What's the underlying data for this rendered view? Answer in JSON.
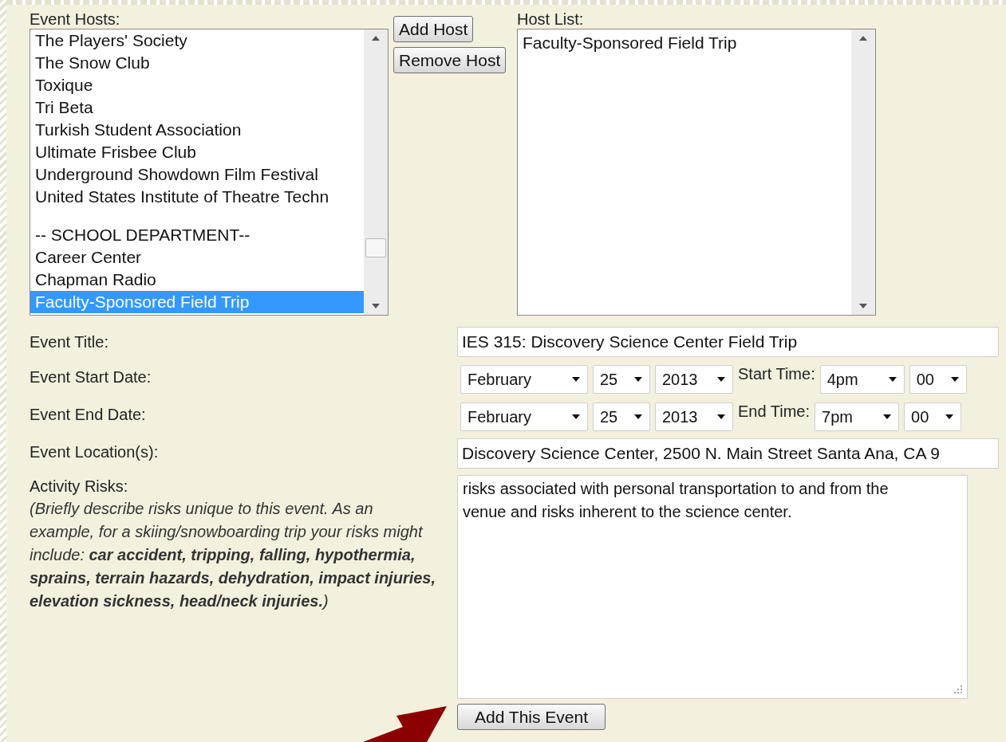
{
  "hosts": {
    "label": "Event Hosts:",
    "options": [
      {
        "kind": "option",
        "text": "The Players' Society",
        "selected": false
      },
      {
        "kind": "option",
        "text": "The Snow Club",
        "selected": false
      },
      {
        "kind": "option",
        "text": "Toxique",
        "selected": false
      },
      {
        "kind": "option",
        "text": "Tri Beta",
        "selected": false
      },
      {
        "kind": "option",
        "text": "Turkish Student Association",
        "selected": false
      },
      {
        "kind": "option",
        "text": "Ultimate Frisbee Club",
        "selected": false
      },
      {
        "kind": "option",
        "text": "Underground Showdown Film Festival",
        "selected": false
      },
      {
        "kind": "option",
        "text": "United States Institute of Theatre Techn",
        "selected": false
      },
      {
        "kind": "group",
        "text": "-- SCHOOL DEPARTMENT--",
        "selected": false
      },
      {
        "kind": "option",
        "text": "Career Center",
        "selected": false
      },
      {
        "kind": "option",
        "text": "Chapman Radio",
        "selected": false
      },
      {
        "kind": "option",
        "text": "Faculty-Sponsored Field Trip",
        "selected": true
      }
    ]
  },
  "host_buttons": [
    "Add Host",
    "Remove Host"
  ],
  "host_list": {
    "label": "Host List:",
    "items": [
      "Faculty-Sponsored Field Trip"
    ]
  },
  "title_row": {
    "label": "Event Title:",
    "value": "IES 315: Discovery Science Center Field Trip"
  },
  "start_row": {
    "label": "Event Start Date:",
    "month": "February",
    "day": "25",
    "year": "2013",
    "time_label": "Start Time:",
    "hour": "4pm",
    "minute": "00"
  },
  "end_row": {
    "label": "Event End Date:",
    "month": "February",
    "day": "25",
    "year": "2013",
    "time_label": "End Time:",
    "hour": "7pm",
    "minute": "00"
  },
  "location_row": {
    "label": "Event Location(s):",
    "value": "Discovery Science Center, 2500 N. Main Street Santa Ana, CA 9"
  },
  "risks": {
    "label": "Activity Risks:",
    "hint": "(Briefly describe risks unique to this event. As an example, for a skiing/snowboarding trip your risks might include: **car accident, tripping, falling, hypothermia, sprains, terrain hazards, dehydration, impact injuries, elevation sickness, head/neck injuries.**)",
    "value": "risks associated with personal transportation to and from the venue and risks inherent to the science center."
  },
  "submit": "Add This Event"
}
